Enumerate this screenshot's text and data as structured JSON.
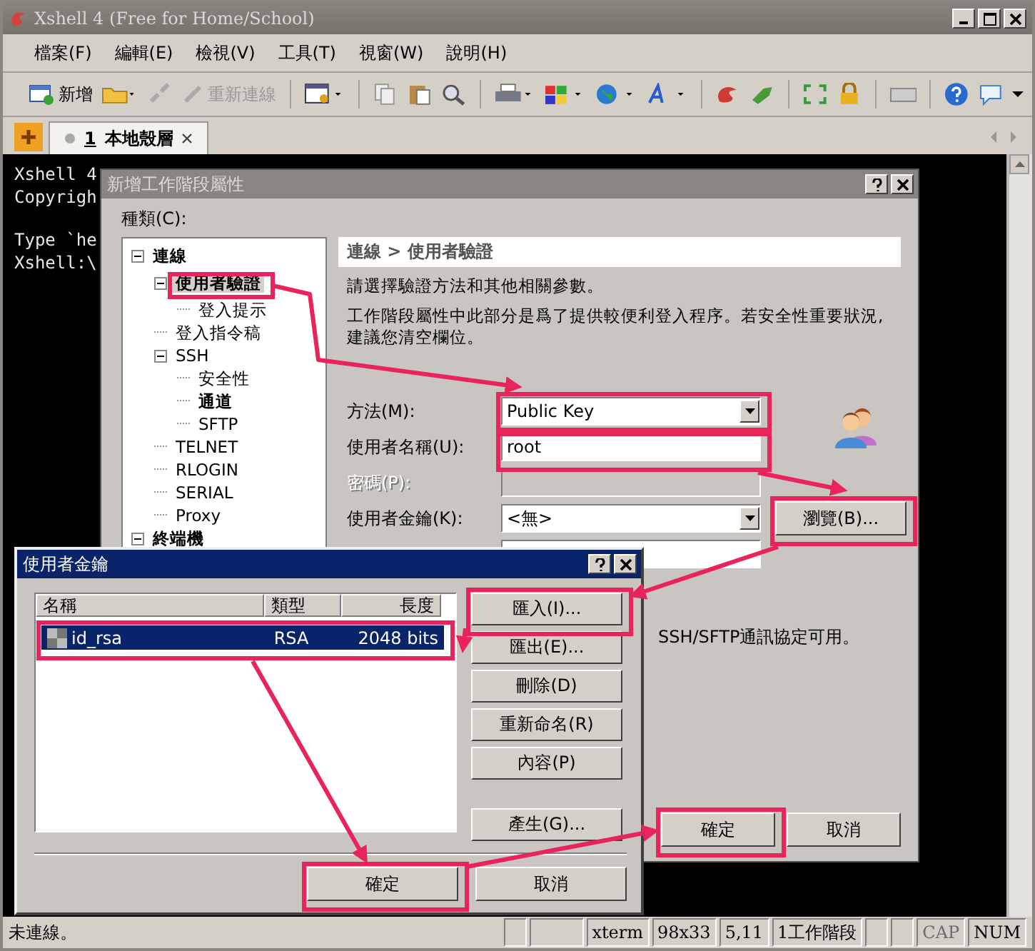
{
  "window": {
    "title": "Xshell 4 (Free for Home/School)"
  },
  "menu": [
    "檔案(F)",
    "編輯(E)",
    "檢視(V)",
    "工具(T)",
    "視窗(W)",
    "說明(H)"
  ],
  "toolbar": {
    "new_label": "新增",
    "reconnect": {
      "label": "重新連線",
      "disabled": true
    }
  },
  "tabs": [
    {
      "number": "1",
      "label": "本地殼層",
      "selected": true
    }
  ],
  "terminal": {
    "paragraphs": [
      [
        "Xshell 4",
        "Copyrigh"
      ],
      [
        "Type `he",
        "Xshell:\\"
      ]
    ]
  },
  "session_dialog": {
    "title": "新增工作階段屬性",
    "category_label": "種類(C):",
    "tree": [
      {
        "label": "連線",
        "bold": true,
        "selected": false,
        "expanded": true,
        "children": [
          {
            "label": "使用者驗證",
            "bold": true,
            "selected": true,
            "expanded": true,
            "children": [
              {
                "label": "登入提示",
                "bold": false,
                "selected": false
              }
            ]
          },
          {
            "label": "登入指令稿",
            "bold": false,
            "selected": false
          },
          {
            "label": "SSH",
            "bold": false,
            "selected": false,
            "expanded": true,
            "children": [
              {
                "label": "安全性",
                "bold": false,
                "selected": false
              },
              {
                "label": "通道",
                "bold": true,
                "selected": false
              },
              {
                "label": "SFTP",
                "bold": false,
                "selected": false
              }
            ]
          },
          {
            "label": "TELNET",
            "bold": false,
            "selected": false
          },
          {
            "label": "RLOGIN",
            "bold": false,
            "selected": false
          },
          {
            "label": "SERIAL",
            "bold": false,
            "selected": false
          },
          {
            "label": "Proxy",
            "bold": false,
            "selected": false
          }
        ]
      },
      {
        "label": "終端機",
        "bold": true,
        "selected": false,
        "expanded": true
      }
    ],
    "breadcrumb": "連線 > 使用者驗證",
    "description": [
      "請選擇驗證方法和其他相關參數。",
      "工作階段屬性中此部分是爲了提供較便利登入程序。若安全性重要狀況,建議您清空欄位。"
    ],
    "fields": [
      {
        "kind": "select",
        "label": "方法(M):",
        "value": "Public Key",
        "disabled": false
      },
      {
        "kind": "text",
        "label": "使用者名稱(U):",
        "value": "root",
        "disabled": false
      },
      {
        "kind": "text",
        "label": "密碼(P):",
        "disabled": true
      },
      {
        "kind": "select",
        "label": "使用者金鑰(K):",
        "value": "<無>",
        "disabled": false
      },
      {
        "kind": "text",
        "disabled": false
      }
    ],
    "browse_button": "瀏覽(B)...",
    "note": "SSH/SFTP通訊協定可用。",
    "buttons": [
      "確定",
      "取消"
    ]
  },
  "key_dialog": {
    "title": "使用者金鑰",
    "columns": [
      "名稱",
      "類型",
      "長度"
    ],
    "rows": [
      {
        "cells": [
          "id_rsa",
          "RSA",
          "2048 bits"
        ],
        "selected": true
      }
    ],
    "side_buttons": [
      "匯入(I)...",
      "匯出(E)...",
      "刪除(D)",
      "重新命名(R)",
      "內容(P)",
      "產生(G)..."
    ],
    "buttons": [
      "確定",
      "取消"
    ]
  },
  "status_bar": {
    "message": "未連線。",
    "panels": [
      "xterm",
      "98x33",
      "5,11",
      "1工作階段"
    ],
    "indicators": [
      {
        "label": "CAP",
        "on": false
      },
      {
        "label": "NUM",
        "on": true
      }
    ]
  }
}
